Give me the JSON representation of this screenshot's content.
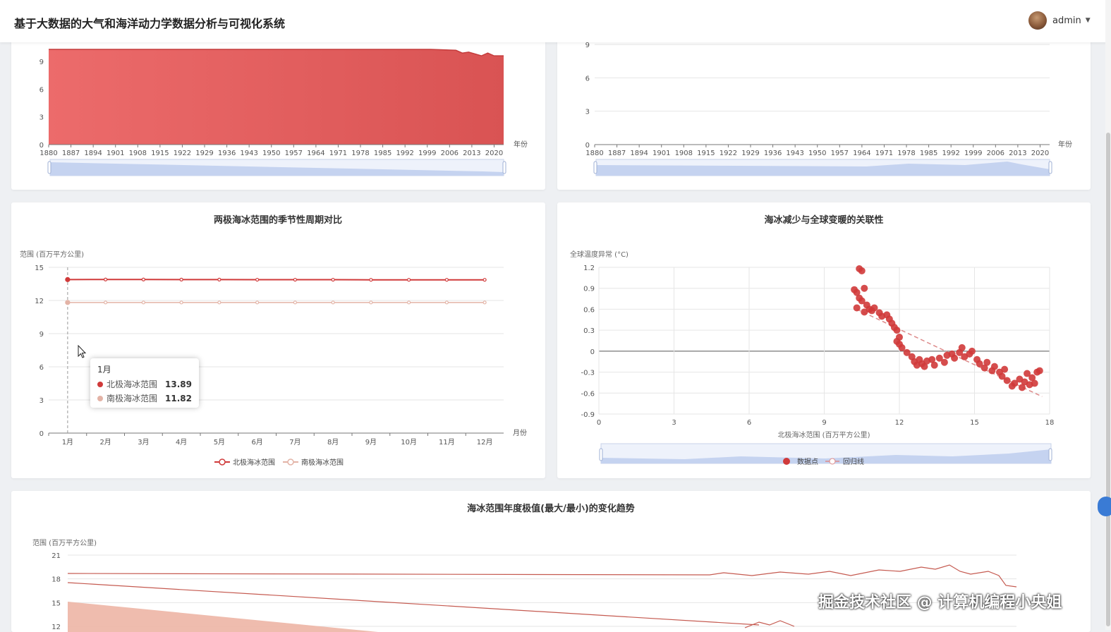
{
  "header": {
    "title": "基于大数据的大气和海洋动力学数据分析与可视化系统",
    "user": "admin"
  },
  "top_left": {
    "x_unit": "年份",
    "y_ticks": [
      "0",
      "3",
      "6",
      "9"
    ],
    "x_ticks": [
      "1880",
      "1887",
      "1894",
      "1901",
      "1908",
      "1915",
      "1922",
      "1929",
      "1936",
      "1943",
      "1950",
      "1957",
      "1964",
      "1971",
      "1978",
      "1985",
      "1992",
      "1999",
      "2006",
      "2013",
      "2020"
    ]
  },
  "top_right": {
    "x_unit": "年份",
    "y_ticks": [
      "0",
      "3",
      "6",
      "9"
    ],
    "x_ticks": [
      "1880",
      "1887",
      "1894",
      "1901",
      "1908",
      "1915",
      "1922",
      "1929",
      "1936",
      "1943",
      "1950",
      "1957",
      "1964",
      "1971",
      "1978",
      "1985",
      "1992",
      "1999",
      "2006",
      "2013",
      "2020"
    ]
  },
  "seasonal": {
    "title": "两极海冰范围的季节性周期对比",
    "ylabel": "范围 (百万平方公里)",
    "xunit": "月份",
    "legend": [
      "北极海冰范围",
      "南极海冰范围"
    ],
    "tooltip": {
      "title": "1月",
      "rows": [
        {
          "name": "北极海冰范围",
          "value": "13.89"
        },
        {
          "name": "南极海冰范围",
          "value": "11.82"
        }
      ]
    }
  },
  "correlation": {
    "title": "海冰减少与全球变暖的关联性",
    "ylabel": "全球温度异常 (°C)",
    "xlabel": "北极海冰范围 (百万平方公里)",
    "legend": [
      "数据点",
      "回归线"
    ]
  },
  "extremes": {
    "title": "海冰范围年度极值(最大/最小)的变化趋势",
    "ylabel": "范围 (百万平方公里)"
  },
  "watermark": "掘金技术社区 @ 计算机编程小央姐",
  "colors": {
    "arctic": "#d03a3a",
    "antarctic": "#e3b3a6",
    "zoom": "#c5d3f0",
    "area_top": "#ec6b6b",
    "area_bottom": "#d95353"
  },
  "chart_data": [
    {
      "type": "area",
      "x": [
        1880,
        1900,
        1920,
        1940,
        1960,
        1980,
        2000,
        2008,
        2010,
        2012,
        2014,
        2016,
        2018,
        2020,
        2023
      ],
      "y": [
        10.3,
        10.3,
        10.3,
        10.3,
        10.3,
        10.3,
        10.3,
        10.2,
        9.9,
        10.0,
        9.8,
        9.6,
        9.9,
        9.6,
        9.6
      ],
      "xlim": [
        1880,
        2023
      ],
      "ylim": [
        0,
        9
      ],
      "x_label": "年份"
    },
    {
      "type": "line",
      "xlim": [
        1880,
        2023
      ],
      "ylim": [
        0,
        9
      ],
      "x_label": "年份"
    },
    {
      "type": "line",
      "title": "两极海冰范围的季节性周期对比",
      "categories": [
        "1月",
        "2月",
        "3月",
        "4月",
        "5月",
        "6月",
        "7月",
        "8月",
        "9月",
        "10月",
        "11月",
        "12月"
      ],
      "series": [
        {
          "name": "北极海冰范围",
          "values": [
            13.89,
            13.9,
            13.9,
            13.89,
            13.89,
            13.88,
            13.88,
            13.88,
            13.87,
            13.87,
            13.87,
            13.87
          ]
        },
        {
          "name": "南极海冰范围",
          "values": [
            11.82,
            11.82,
            11.82,
            11.82,
            11.82,
            11.82,
            11.82,
            11.82,
            11.82,
            11.82,
            11.82,
            11.82
          ]
        }
      ],
      "ylim": [
        0,
        15
      ],
      "y_ticks": [
        0,
        3,
        6,
        9,
        12,
        15
      ],
      "ylabel": "范围 (百万平方公里)",
      "xlabel": "月份"
    },
    {
      "type": "scatter",
      "title": "海冰减少与全球变暖的关联性",
      "xlim": [
        0,
        18
      ],
      "ylim": [
        -0.9,
        1.2
      ],
      "x_ticks": [
        0,
        3,
        6,
        9,
        12,
        15,
        18
      ],
      "y_ticks": [
        -0.9,
        -0.6,
        -0.3,
        0,
        0.3,
        0.6,
        0.9,
        1.2
      ],
      "xlabel": "北极海冰范围 (百万平方公里)",
      "ylabel": "全球温度异常 (°C)",
      "points": [
        [
          10.4,
          1.18
        ],
        [
          10.5,
          1.15
        ],
        [
          10.2,
          0.88
        ],
        [
          10.3,
          0.84
        ],
        [
          10.6,
          0.9
        ],
        [
          10.4,
          0.76
        ],
        [
          10.5,
          0.72
        ],
        [
          10.7,
          0.66
        ],
        [
          10.3,
          0.62
        ],
        [
          10.8,
          0.6
        ],
        [
          10.9,
          0.58
        ],
        [
          11.0,
          0.62
        ],
        [
          10.6,
          0.56
        ],
        [
          11.2,
          0.55
        ],
        [
          11.3,
          0.5
        ],
        [
          11.5,
          0.52
        ],
        [
          11.6,
          0.46
        ],
        [
          11.7,
          0.4
        ],
        [
          11.8,
          0.34
        ],
        [
          11.9,
          0.3
        ],
        [
          12.0,
          0.2
        ],
        [
          12.0,
          0.1
        ],
        [
          11.9,
          0.14
        ],
        [
          12.1,
          0.05
        ],
        [
          12.3,
          -0.02
        ],
        [
          12.5,
          -0.08
        ],
        [
          12.6,
          -0.15
        ],
        [
          12.8,
          -0.12
        ],
        [
          12.7,
          -0.2
        ],
        [
          12.9,
          -0.18
        ],
        [
          13.0,
          -0.22
        ],
        [
          13.1,
          -0.14
        ],
        [
          13.3,
          -0.12
        ],
        [
          13.4,
          -0.2
        ],
        [
          13.6,
          -0.1
        ],
        [
          13.8,
          -0.16
        ],
        [
          13.9,
          -0.06
        ],
        [
          14.1,
          -0.04
        ],
        [
          14.2,
          -0.1
        ],
        [
          14.4,
          -0.02
        ],
        [
          14.5,
          0.05
        ],
        [
          14.6,
          -0.08
        ],
        [
          14.8,
          -0.04
        ],
        [
          14.9,
          0.0
        ],
        [
          15.1,
          -0.12
        ],
        [
          15.2,
          -0.18
        ],
        [
          15.4,
          -0.24
        ],
        [
          15.5,
          -0.16
        ],
        [
          15.7,
          -0.28
        ],
        [
          15.8,
          -0.22
        ],
        [
          16.0,
          -0.3
        ],
        [
          16.1,
          -0.36
        ],
        [
          16.2,
          -0.26
        ],
        [
          16.3,
          -0.42
        ],
        [
          16.5,
          -0.5
        ],
        [
          16.6,
          -0.46
        ],
        [
          16.8,
          -0.4
        ],
        [
          16.9,
          -0.52
        ],
        [
          17.0,
          -0.44
        ],
        [
          17.1,
          -0.32
        ],
        [
          17.2,
          -0.48
        ],
        [
          17.3,
          -0.38
        ],
        [
          17.4,
          -0.46
        ],
        [
          17.5,
          -0.3
        ],
        [
          17.6,
          -0.28
        ]
      ],
      "regression": [
        [
          10.3,
          0.6
        ],
        [
          17.7,
          -0.65
        ]
      ]
    },
    {
      "type": "line",
      "title": "海冰范围年度极值(最大/最小)的变化趋势",
      "ylabel": "范围 (百万平方公里)",
      "ylim": [
        12,
        21
      ],
      "y_ticks": [
        12,
        15,
        18,
        21
      ]
    }
  ]
}
